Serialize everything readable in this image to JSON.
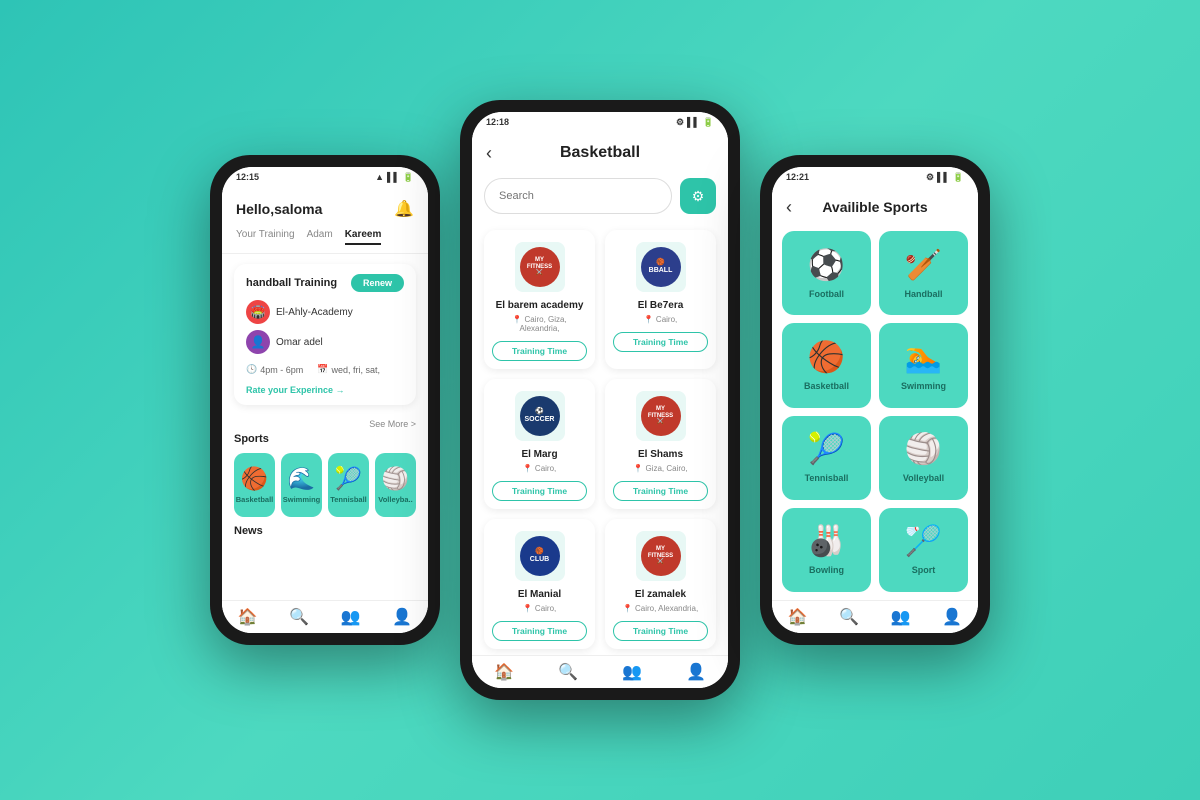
{
  "background_color": "#3ecfb8",
  "phone1": {
    "status_time": "12:15",
    "greeting": "Hello,saloma",
    "bell_icon": "🔔",
    "tabs": [
      "Your Training",
      "Adam",
      "Kareem"
    ],
    "active_tab": "Kareem",
    "card_title": "handball Training",
    "renew_label": "Renew",
    "club_name": "El-Ahly-Academy",
    "coach_name": "Omar adel",
    "time_label": "4pm - 6pm",
    "days_label": "wed, fri, sat,",
    "rate_label": "Rate your Experince →",
    "see_more": "See More >",
    "sports_title": "Sports",
    "sports": [
      {
        "label": "Basketball",
        "emoji": "🏀"
      },
      {
        "label": "Swimming",
        "emoji": "🏊"
      },
      {
        "label": "Tennisball",
        "emoji": "🎾"
      },
      {
        "label": "Volleyba..",
        "emoji": "🏐"
      }
    ],
    "news_title": "News",
    "nav_items": [
      "🏠",
      "🔍",
      "👥",
      "👤"
    ]
  },
  "phone2": {
    "status_time": "12:18",
    "back_label": "‹",
    "title": "Basketball",
    "search_placeholder": "Search",
    "filter_icon": "⚙",
    "clubs": [
      {
        "name": "El barem academy",
        "location": "Cairo, Giza, Alexandria,",
        "logo_type": "fitness",
        "training_label": "Training Time"
      },
      {
        "name": "El Be7era",
        "location": "Cairo,",
        "logo_type": "basketball",
        "training_label": "Training Time"
      },
      {
        "name": "El Marg",
        "location": "Cairo,",
        "logo_type": "soccer",
        "training_label": "Training Time"
      },
      {
        "name": "El Shams",
        "location": "Giza, Cairo,",
        "logo_type": "fitness2",
        "training_label": "Training Time"
      },
      {
        "name": "El Manial",
        "location": "Cairo,",
        "logo_type": "basket2",
        "training_label": "Training Time"
      },
      {
        "name": "El zamalek",
        "location": "Cairo, Alexandria,",
        "logo_type": "fitness3",
        "training_label": "Training Time"
      }
    ],
    "nav_items": [
      "🏠",
      "🔍",
      "👥",
      "👤"
    ]
  },
  "phone3": {
    "status_time": "12:21",
    "back_label": "‹",
    "title": "Availible Sports",
    "sports": [
      {
        "label": "Football",
        "emoji": "⚽"
      },
      {
        "label": "Handball",
        "emoji": "🏏"
      },
      {
        "label": "Basketball",
        "emoji": "🏀"
      },
      {
        "label": "Swimming",
        "emoji": "🏊"
      },
      {
        "label": "Tennisball",
        "emoji": "🎾"
      },
      {
        "label": "Volleyball",
        "emoji": "🏐"
      },
      {
        "label": "Bowling",
        "emoji": "🎳"
      },
      {
        "label": "Sport",
        "emoji": "🏸"
      }
    ],
    "nav_items": [
      "🏠",
      "🔍",
      "👥",
      "👤"
    ]
  }
}
